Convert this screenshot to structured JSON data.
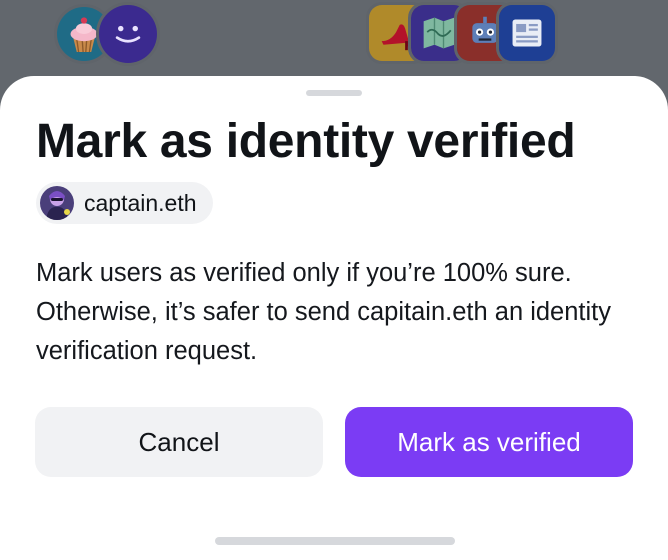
{
  "background": {
    "avatars_left": [
      {
        "icon": "cupcake-icon"
      },
      {
        "icon": "smiley-face-icon"
      }
    ],
    "avatars_right": [
      {
        "icon": "high-heel-shoe-icon"
      },
      {
        "icon": "map-icon"
      },
      {
        "icon": "robot-icon"
      },
      {
        "icon": "newspaper-icon"
      }
    ]
  },
  "sheet": {
    "title": "Mark as identity verified",
    "user": {
      "name": "captain.eth",
      "avatar_icon": "user-avatar-icon"
    },
    "message": "Mark users as verified only if you’re 100% sure. Otherwise, it’s safer to send capitain.eth an identity verification request.",
    "cancel_label": "Cancel",
    "confirm_label": "Mark as verified"
  },
  "colors": {
    "accent": "#7b3cf4",
    "secondary_button": "#f1f2f4",
    "text": "#111418",
    "overlay": "#5f646a"
  }
}
